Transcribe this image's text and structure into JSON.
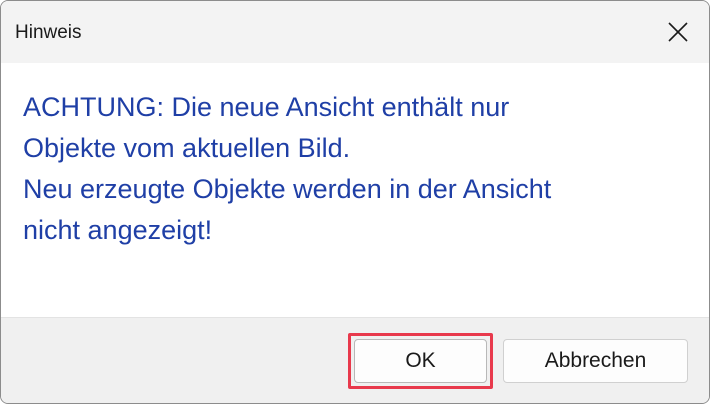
{
  "dialog": {
    "title": "Hinweis",
    "message_lines": [
      "ACHTUNG: Die neue Ansicht enthält nur",
      "Objekte vom aktuellen Bild.",
      "Neu erzeugte Objekte werden in der Ansicht",
      "nicht angezeigt!"
    ],
    "buttons": {
      "ok_label": "OK",
      "cancel_label": "Abbrechen"
    }
  },
  "colors": {
    "message_text": "#1f3fa6",
    "highlight": "#e8394c"
  },
  "icons": {
    "close": "close-icon"
  }
}
